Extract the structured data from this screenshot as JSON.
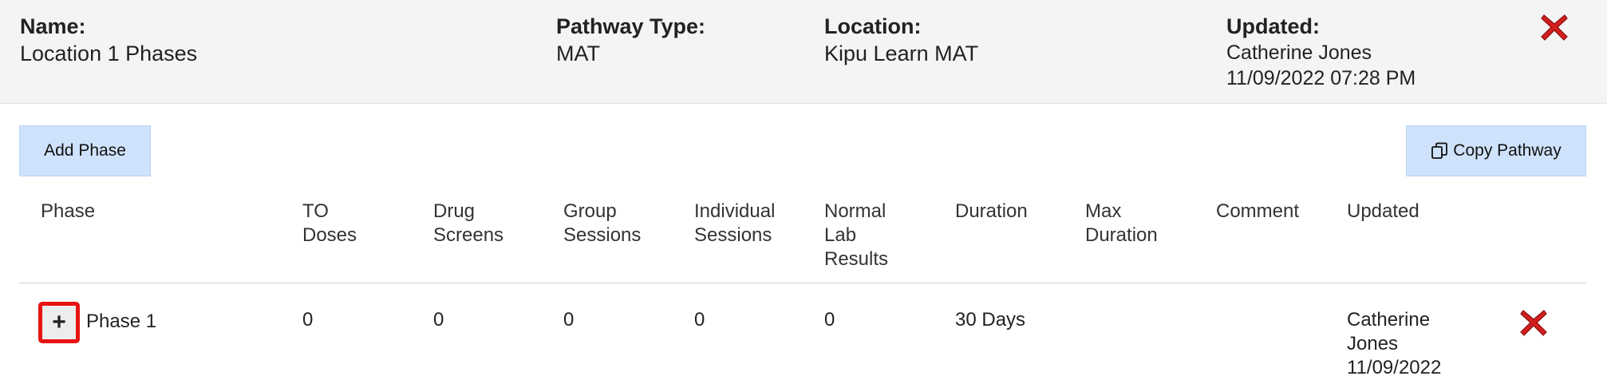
{
  "header": {
    "name_label": "Name:",
    "name_value": "Location 1 Phases",
    "pathway_type_label": "Pathway Type:",
    "pathway_type_value": "MAT",
    "location_label": "Location:",
    "location_value": "Kipu Learn MAT",
    "updated_label": "Updated:",
    "updated_by": "Catherine Jones",
    "updated_at": "11/09/2022 07:28 PM",
    "close_icon": "close-x-icon"
  },
  "toolbar": {
    "add_phase_label": "Add Phase",
    "copy_pathway_label": "Copy Pathway",
    "copy_icon": "copy-icon"
  },
  "table": {
    "columns": [
      [
        "Phase"
      ],
      [
        "TO",
        "Doses"
      ],
      [
        "Drug",
        "Screens"
      ],
      [
        "Group",
        "Sessions"
      ],
      [
        "Individual",
        "Sessions"
      ],
      [
        "Normal",
        "Lab",
        "Results"
      ],
      [
        "Duration"
      ],
      [
        "Max",
        "Duration"
      ],
      [
        "Comment"
      ],
      [
        "Updated"
      ]
    ],
    "rows": [
      {
        "expand_symbol": "+",
        "phase": "Phase 1",
        "to_doses": "0",
        "drug_screens": "0",
        "group_sessions": "0",
        "individual_sessions": "0",
        "normal_lab_results": "0",
        "duration": "30 Days",
        "max_duration": "",
        "comment": "",
        "updated_lines": [
          "Catherine",
          "Jones",
          "11/09/2022"
        ]
      }
    ]
  },
  "colors": {
    "header_bg": "#f4f4f4",
    "button_bg": "#cfe2fb",
    "delete_red": "#d21f1f",
    "highlight_red": "#e81313"
  }
}
